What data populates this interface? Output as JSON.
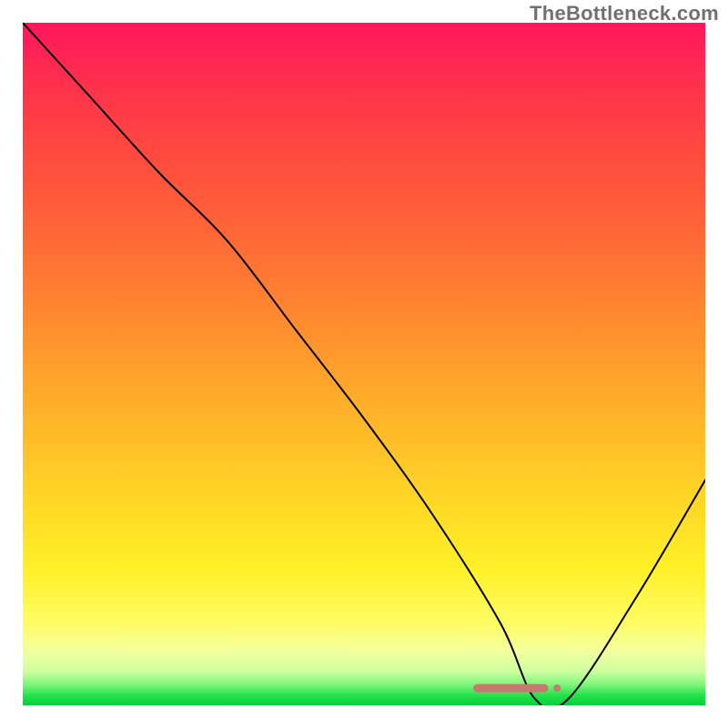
{
  "watermark": "TheBottleneck.com",
  "chart_data": {
    "type": "line",
    "title": "",
    "xlabel": "",
    "ylabel": "",
    "xlim": [
      0,
      100
    ],
    "ylim": [
      0,
      100
    ],
    "grid": false,
    "series": [
      {
        "name": "curve",
        "x": [
          0,
          10,
          20,
          30,
          40,
          50,
          60,
          70,
          75,
          80,
          90,
          100
        ],
        "y": [
          100,
          89,
          78,
          68,
          55,
          42,
          28,
          12,
          1,
          1,
          16,
          33
        ]
      }
    ],
    "marker": {
      "x_start": 66,
      "x_end": 77,
      "y": 2.5,
      "color": "#c57a70"
    },
    "gradient_stops": [
      {
        "pos": 0,
        "color": "#ff165d"
      },
      {
        "pos": 0.5,
        "color": "#ff9a2e"
      },
      {
        "pos": 0.85,
        "color": "#fff23a"
      },
      {
        "pos": 1.0,
        "color": "#00d235"
      }
    ]
  }
}
